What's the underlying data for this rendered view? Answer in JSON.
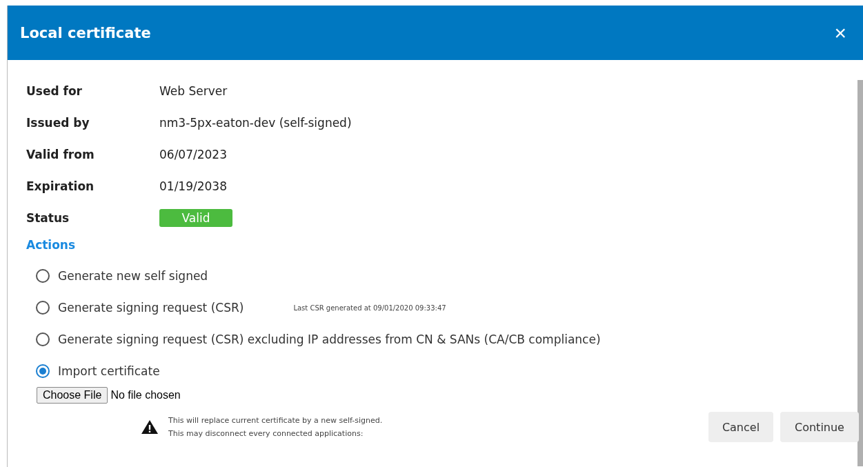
{
  "window": {
    "title": "Local certificate",
    "close": "×"
  },
  "fields": [
    {
      "label": "Used for",
      "value": "Web Server",
      "kind": "text"
    },
    {
      "label": "Issued by",
      "value": "nm3-5px-eaton-dev (self-signed)",
      "kind": "text"
    },
    {
      "label": "Valid from",
      "value": "06/07/2023",
      "kind": "text"
    },
    {
      "label": "Expiration",
      "value": "01/19/2038",
      "kind": "text"
    },
    {
      "label": "Status",
      "value": "Valid",
      "kind": "badge",
      "color": "#4cbb3f"
    }
  ],
  "actions": {
    "heading": "Actions",
    "options": [
      {
        "label": "Generate new self signed",
        "selected": false
      },
      {
        "label": "Generate signing request (CSR)",
        "selected": false,
        "note": "Last CSR generated at 09/01/2020 09:33:47"
      },
      {
        "label": "Generate signing request (CSR) excluding IP addresses from CN & SANs (CA/CB compliance)",
        "selected": false
      },
      {
        "label": "Import certificate",
        "selected": true
      }
    ]
  },
  "file_input": {
    "button": "Choose File",
    "value": "No file chosen"
  },
  "warning": [
    "This will replace current certificate by a new self-signed.",
    "This may disconnect every connected applications:"
  ],
  "buttons": [
    "Cancel",
    "Continue"
  ]
}
